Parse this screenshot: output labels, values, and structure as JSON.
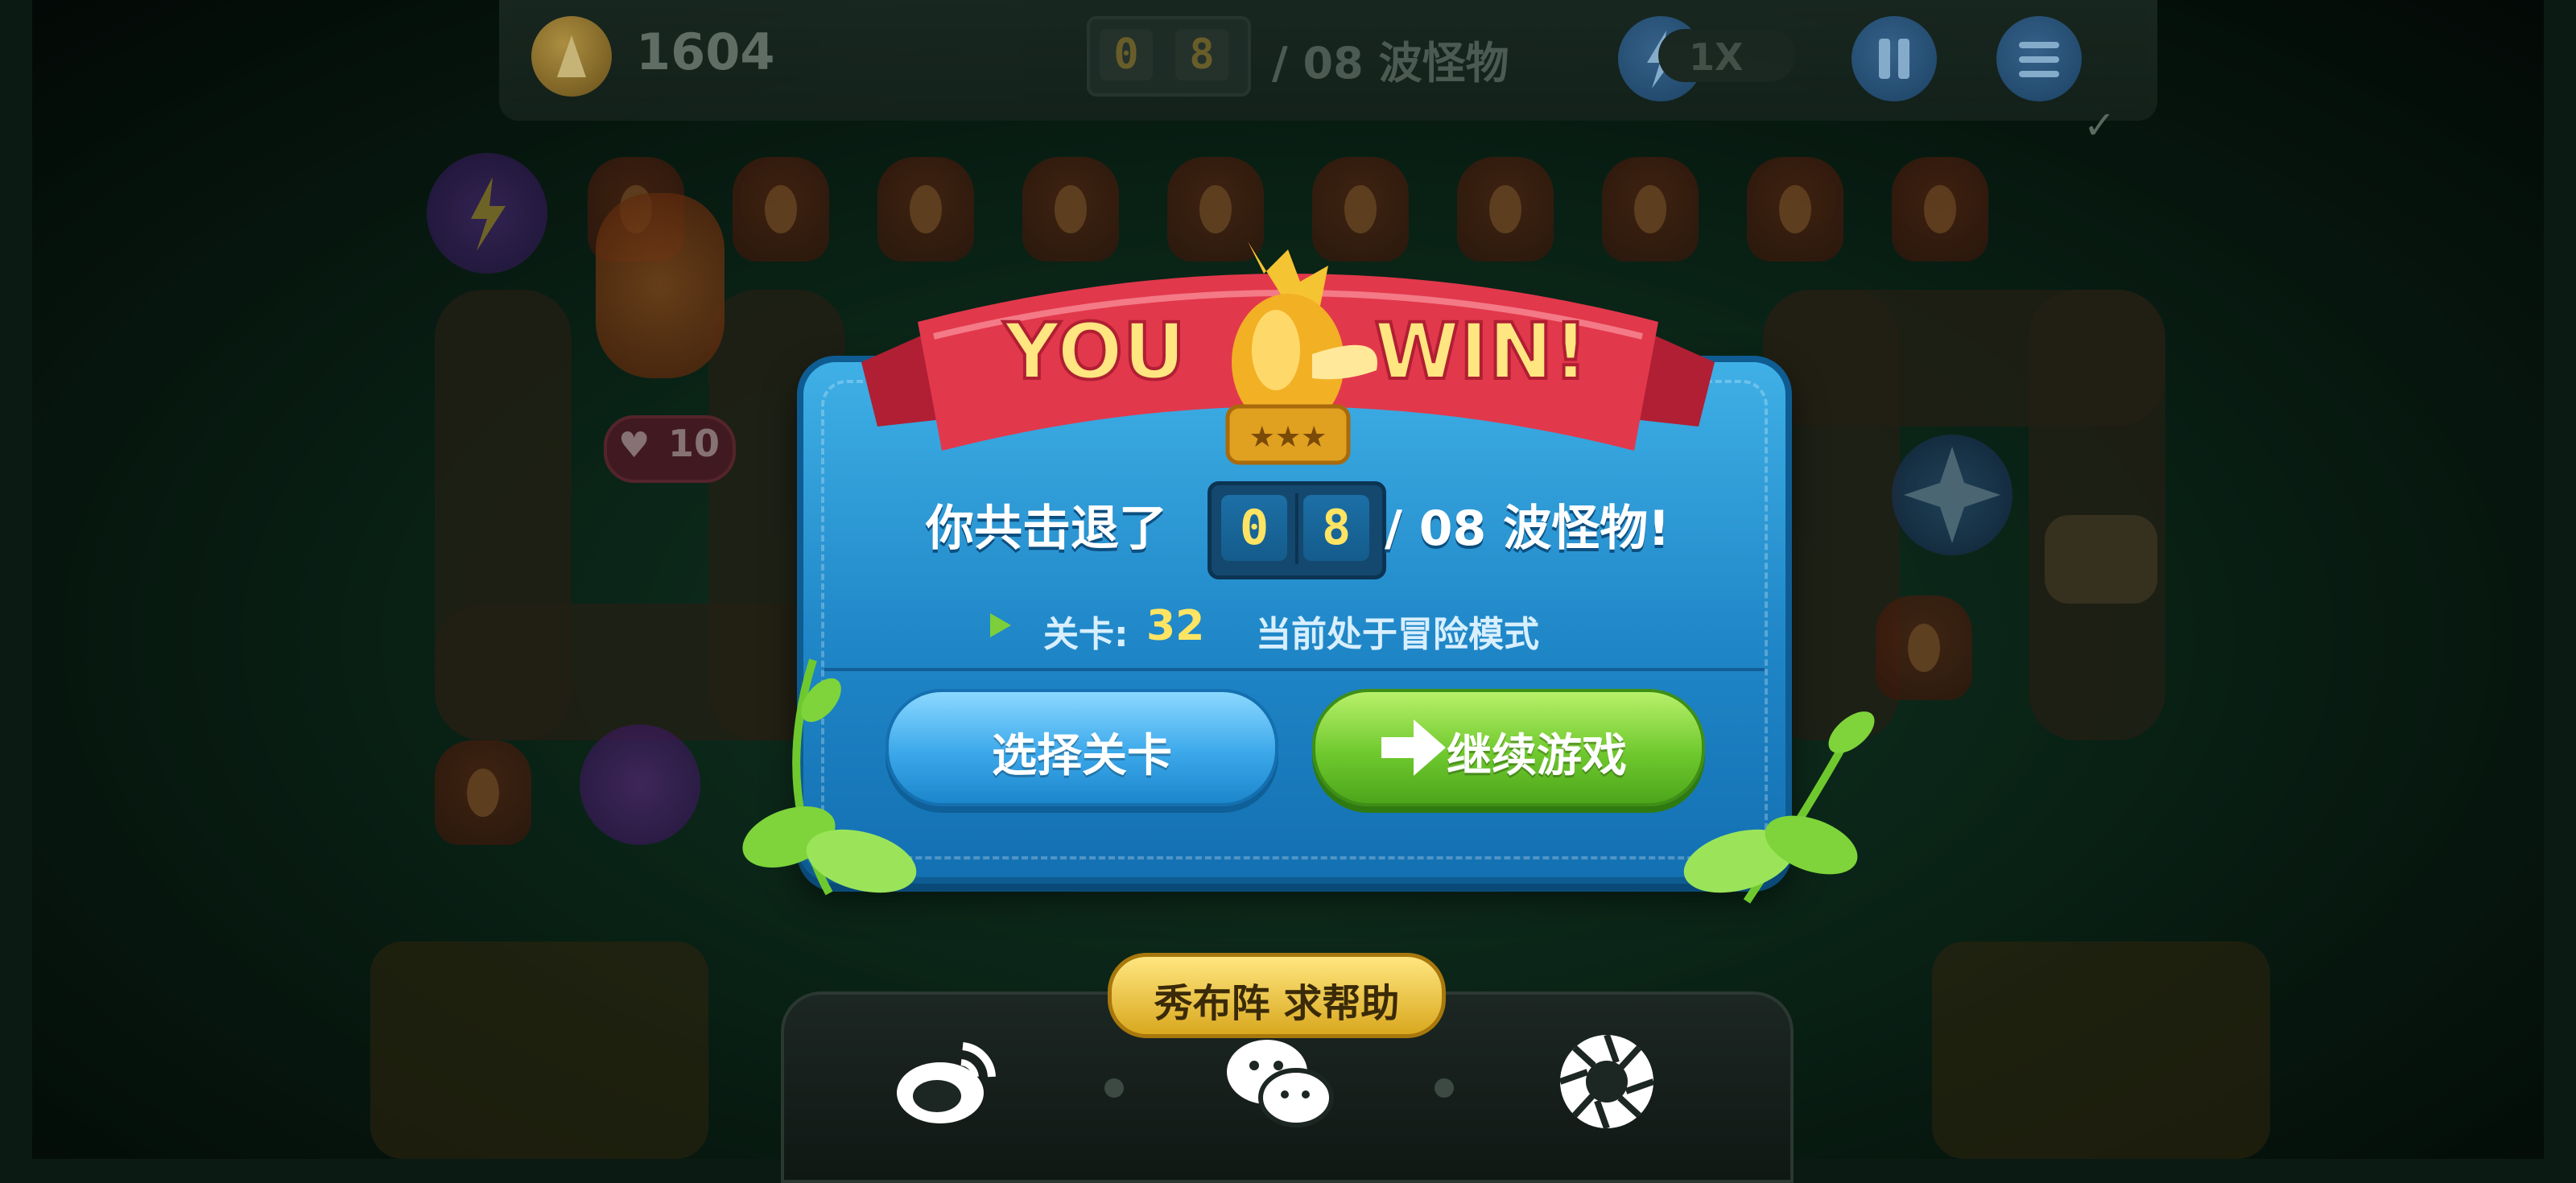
{
  "hud": {
    "coins": "1604",
    "wave_digit_1": "0",
    "wave_digit_2": "8",
    "wave_total": "/ 08 波怪物",
    "speed": "1X"
  },
  "board": {
    "carrot_hp": "10"
  },
  "result": {
    "banner_left": "YOU",
    "banner_right": "WIN!",
    "stars": 3,
    "killed_prefix": "你共击退了",
    "counter_digit_1": "0",
    "counter_digit_2": "8",
    "killed_suffix": "/ 08 波怪物!",
    "level_label": "关卡:",
    "level_number": "32",
    "mode_text": "当前处于冒险模式"
  },
  "buttons": {
    "select_level": "选择关卡",
    "continue_game": "继续游戏"
  },
  "share": {
    "title": "秀布阵 求帮助",
    "icons": [
      "weibo-icon",
      "wechat-icon",
      "moments-icon"
    ]
  },
  "colors": {
    "panel_blue": "#1f86c7",
    "ribbon_red": "#e2384c",
    "gold": "#ffe463",
    "continue_green": "#6fc92e"
  }
}
